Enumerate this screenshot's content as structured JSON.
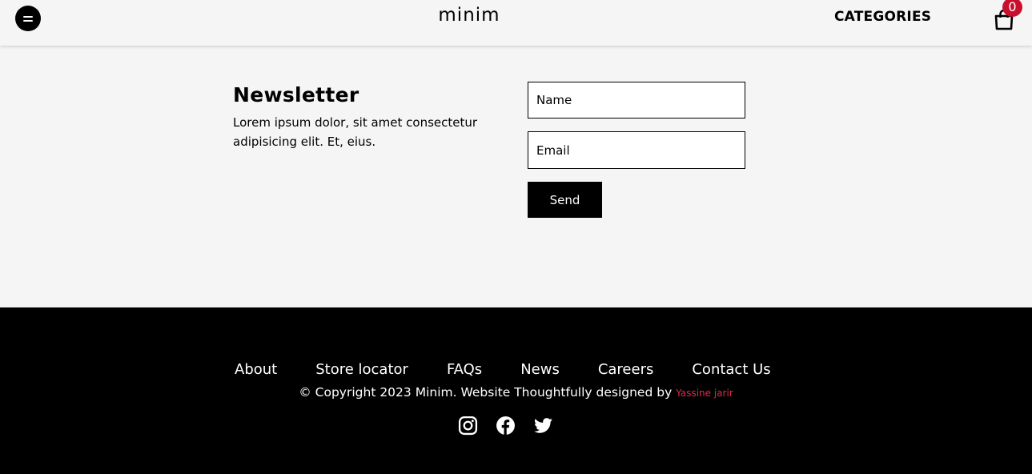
{
  "header": {
    "logo": "minim",
    "categories_label": "CATEGORIES",
    "cart_count": "0"
  },
  "newsletter": {
    "title": "Newsletter",
    "description": "Lorem ipsum dolor, sit amet consectetur adipisicing elit. Et, eius.",
    "name_placeholder": "Name",
    "email_placeholder": "Email",
    "send_label": "Send"
  },
  "footer": {
    "links": [
      "About",
      "Store locator",
      "FAQs",
      "News",
      "Careers",
      "Contact Us"
    ],
    "copyright": "© Copyright 2023 Minim. Website Thoughtfully designed by",
    "designer": "Yassine jarir",
    "socials": [
      "instagram-icon",
      "facebook-icon",
      "twitter-icon"
    ]
  },
  "colors": {
    "background": "#f5f5f5",
    "footer": "#000000",
    "badge": "#c8102e",
    "designer_link": "#e0284a"
  }
}
